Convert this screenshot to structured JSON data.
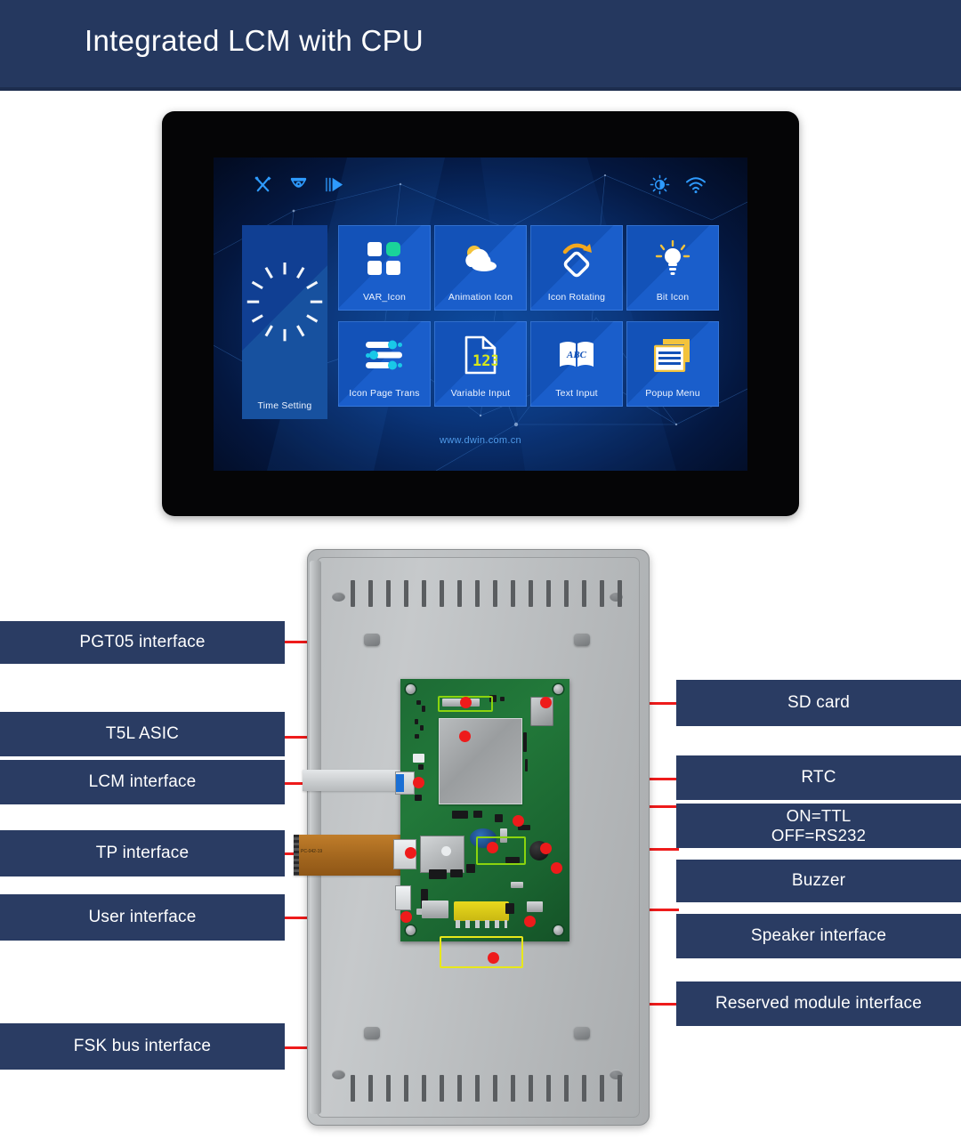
{
  "header": {
    "title": "Integrated LCM with CPU"
  },
  "lcd": {
    "status_icons": [
      {
        "name": "tools-icon"
      },
      {
        "name": "dome-camera-icon"
      },
      {
        "name": "play-icon"
      },
      {
        "name": "brightness-icon"
      },
      {
        "name": "wifi-icon"
      }
    ],
    "tiles": [
      {
        "label": "Time Setting",
        "icon": "clock-dial-icon"
      },
      {
        "label": "VAR_Icon",
        "icon": "four-squares-icon"
      },
      {
        "label": "Animation Icon",
        "icon": "cloud-sun-icon"
      },
      {
        "label": "Icon Rotating",
        "icon": "rotating-diamond-icon"
      },
      {
        "label": "Bit Icon",
        "icon": "lightbulb-icon"
      },
      {
        "label": "Icon Page Trans",
        "icon": "sliders-icon"
      },
      {
        "label": "Variable Input",
        "icon": "numeric-page-icon"
      },
      {
        "label": "Text Input",
        "icon": "abc-book-icon"
      },
      {
        "label": "Popup Menu",
        "icon": "stacked-windows-icon"
      }
    ],
    "url": "www.dwin.com.cn"
  },
  "diagram": {
    "left_labels": [
      {
        "text": "PGT05 interface"
      },
      {
        "text": "T5L  ASIC"
      },
      {
        "text": "LCM interface"
      },
      {
        "text": "TP interface"
      },
      {
        "text": "User interface"
      },
      {
        "text": "FSK bus interface"
      }
    ],
    "right_labels": [
      {
        "text": "SD card"
      },
      {
        "text": "RTC"
      },
      {
        "text": "ON=TTL\nOFF=RS232",
        "line1": "ON=TTL",
        "line2": "OFF=RS232"
      },
      {
        "text": "Buzzer"
      },
      {
        "text": "Speaker interface"
      },
      {
        "text": "Reserved module interface"
      }
    ],
    "flex_cable_marking": "PC-042-19"
  },
  "colors": {
    "navy": "#25385f",
    "bar_navy": "#2a3c63",
    "leader_red": "#ee1b1b",
    "highlight_green": "#8bd40e",
    "highlight_yellow": "#e8e81a",
    "tile_blue": "#1352b8",
    "pcb_green": "#1d6b34"
  }
}
